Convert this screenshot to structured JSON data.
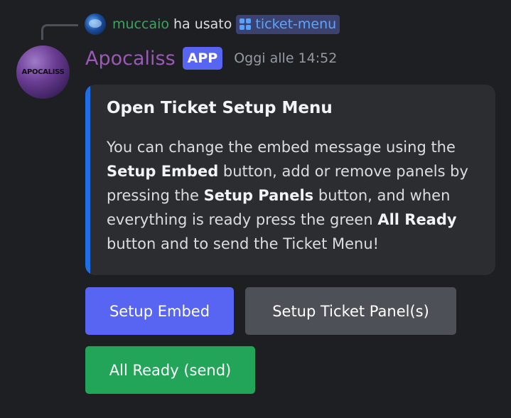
{
  "reply": {
    "username": "muccaio",
    "action": "ha usato",
    "command": "ticket-menu",
    "user_color": "#3ba55d",
    "command_icon": "slash-command-icon"
  },
  "message": {
    "author": "Apocaliss",
    "author_color": "#9b59b6",
    "badge": "APP",
    "timestamp": "Oggi alle 14:52",
    "avatar_text": "APOCALISS"
  },
  "embed": {
    "accent_color": "#1e6ee8",
    "title": "Open Ticket Setup Menu",
    "description": {
      "p1": "You can change the embed message using the ",
      "b1": "Setup Embed",
      "p2": " button, add or remove panels by pressing the ",
      "b2": "Setup Panels",
      "p3": " button, and when everything is ready press the green ",
      "b3": "All Ready",
      "p4": " button and to send the Ticket Menu!"
    }
  },
  "buttons": {
    "setup_embed": "Setup Embed",
    "setup_panels": "Setup Ticket Panel(s)",
    "all_ready": "All Ready (send)"
  }
}
